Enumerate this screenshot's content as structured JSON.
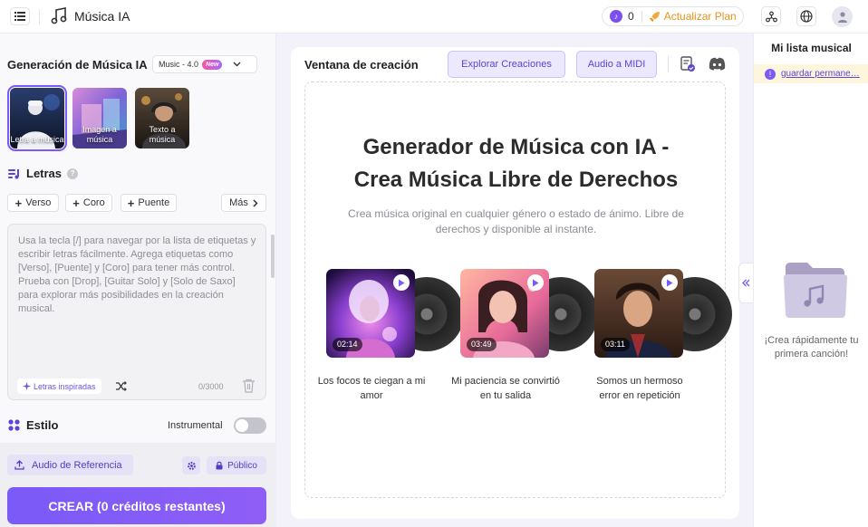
{
  "header": {
    "app_title": "Música IA",
    "credit_count": "0",
    "credit_coin": "♪",
    "upgrade_label": "Actualizar Plan",
    "icons": [
      "menu-icon",
      "music-note-icon",
      "credit-coin-icon",
      "rocket-icon",
      "share-network-icon",
      "globe-icon",
      "user-avatar-icon"
    ]
  },
  "left": {
    "generator_title": "Generación de Música IA",
    "model": {
      "selected": "Music - 4.0",
      "badge": "New"
    },
    "modes": [
      {
        "label": "Letra a música",
        "selected": true
      },
      {
        "label": "Imagen a música",
        "selected": false
      },
      {
        "label": "Texto a música",
        "selected": false
      }
    ],
    "lyrics": {
      "title": "Letras",
      "tags": [
        "Verso",
        "Coro",
        "Puente"
      ],
      "more_label": "Más",
      "placeholder": "Usa la tecla [/] para navegar por la lista de etiquetas y escribir letras fácilmente. Agrega etiquetas como [Verso], [Puente] y [Coro] para tener más control. Prueba con [Drop], [Guitar Solo] y [Solo de Saxo] para explorar más posibilidades en la creación musical.",
      "inspired_label": "Letras inspiradas",
      "char_count": "0/3000"
    },
    "style": {
      "title": "Estilo",
      "instrumental_label": "Instrumental",
      "instrumental_on": false
    },
    "reference_audio_label": "Audio de Referencia",
    "public_label": "Público",
    "create_label": "CREAR (0 créditos restantes)"
  },
  "main": {
    "window_title": "Ventana de creación",
    "explore_label": "Explorar Creaciones",
    "midi_label": "Audio a MIDI",
    "hero_title_line1": "Generador de Música con IA -",
    "hero_title_line2": "Crea Música Libre de Derechos",
    "hero_subtitle": "Crea música original en cualquier género o estado de ánimo. Libre de derechos y disponible al instante.",
    "songs": [
      {
        "title": "Los focos te ciegan a mi amor",
        "duration": "02:14"
      },
      {
        "title": "Mi paciencia se convirtió en tu salida",
        "duration": "03:49"
      },
      {
        "title": "Somos un hermoso error en repetición",
        "duration": "03:11"
      }
    ]
  },
  "right": {
    "title": "Mi lista musical",
    "notice_link": "guardar permane…",
    "empty_text": "¡Crea rápidamente tu primera canción!"
  },
  "colors": {
    "accent": "#7a5af8",
    "upgrade": "#e3941c",
    "notice_bg": "#fdf6dd"
  }
}
